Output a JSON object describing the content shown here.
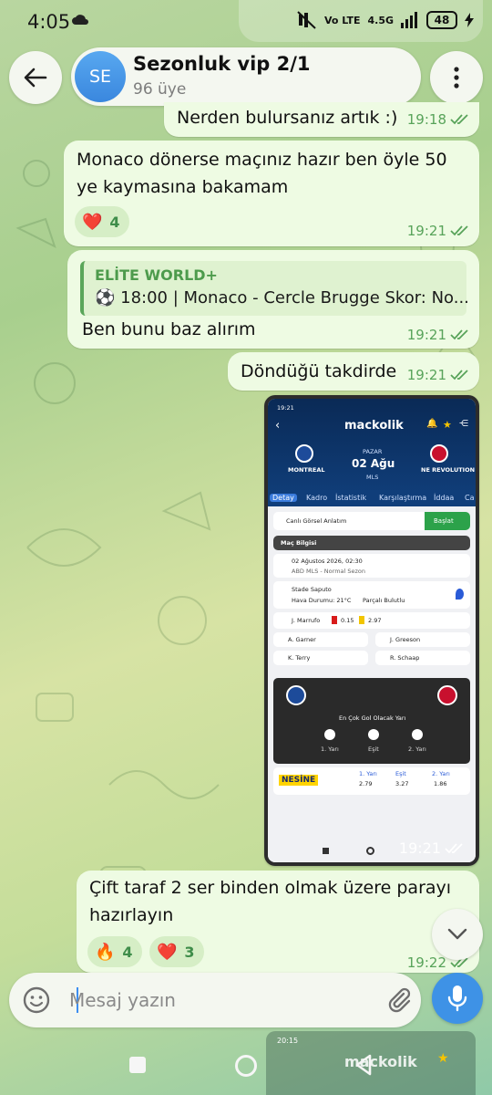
{
  "status_bar": {
    "time": "4:05",
    "network": "4.5G",
    "volte": "Vo LTE",
    "battery": "48"
  },
  "header": {
    "avatar_initials": "SE",
    "title": "Sezonluk vip 2/1",
    "subtitle": "96 üye"
  },
  "messages": [
    {
      "text": "Nerden bulursanız artık :)",
      "time": "19:18"
    },
    {
      "text_line1": "Monaco dönerse maçınız hazır ben öyle 50",
      "text_line2": "ye kaymasına bakamam",
      "time": "19:21",
      "reaction_emoji": "❤️",
      "reaction_count": "4"
    },
    {
      "reply_title": "ELİTE WORLD+",
      "reply_text": "⚽ 18:00 | Monaco - Cercle Brugge Skor: No...",
      "text": "Ben bunu baz alırım",
      "time": "19:21"
    },
    {
      "text": "Döndüğü takdirde",
      "time": "19:21"
    },
    {
      "image_time": "19:21"
    },
    {
      "text_line1": "Çift taraf 2 ser binden olmak üzere parayı",
      "text_line2": "hazırlayın",
      "time": "19:22",
      "reaction1_emoji": "🔥",
      "reaction1_count": "4",
      "reaction2_emoji": "❤️",
      "reaction2_count": "3"
    }
  ],
  "screenshot": {
    "status_time": "19:21",
    "app_name": "mackolik",
    "day": "PAZAR",
    "date": "02 Ağu",
    "league": "MLS",
    "home_team": "MONTREAL",
    "away_team": "NE REVOLUTION",
    "tabs": [
      "Detay",
      "Kadro",
      "İstatistik",
      "Karşılaştırma",
      "İddaa",
      "Ca"
    ],
    "live_label": "Canlı Görsel Anlatım",
    "live_button": "Başlat",
    "section_title": "Maç Bilgisi",
    "match_datetime": "02 Ağustos 2026, 02:30",
    "competition": "ABD MLS - Normal Sezon",
    "stadium": "Stade Saputo",
    "weather": "Hava Durumu: 21°C",
    "weather_desc": "Parçalı Bulutlu",
    "referee_row": "J. Marrufo",
    "ref_red": "0.15",
    "ref_yellow": "2.97",
    "officials": [
      "A. Garner",
      "J. Greeson",
      "K. Terry",
      "R. Schaap"
    ],
    "poll_title": "En Çok Gol Olacak Yarı",
    "poll_options": [
      "1. Yarı",
      "Eşit",
      "2. Yarı"
    ],
    "bookmaker": "NESİNE",
    "odds": [
      {
        "label": "1. Yarı",
        "value": "2.79"
      },
      {
        "label": "Eşit",
        "value": "3.27"
      },
      {
        "label": "2. Yarı",
        "value": "1.86"
      }
    ]
  },
  "composer": {
    "placeholder": "Mesaj yazın"
  },
  "pip": {
    "time": "20:15",
    "app_name": "mackolik"
  }
}
